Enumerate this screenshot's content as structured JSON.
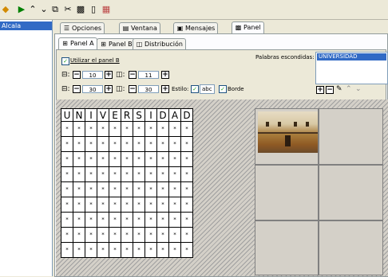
{
  "sidebar": {
    "items": [
      {
        "label": "Alcala"
      }
    ]
  },
  "tabs_main": [
    {
      "label": "Opciones",
      "icon": "options-icon"
    },
    {
      "label": "Ventana",
      "icon": "window-icon"
    },
    {
      "label": "Mensajes",
      "icon": "messages-icon"
    },
    {
      "label": "Panel",
      "icon": "panel-icon"
    }
  ],
  "tabs_sub": [
    {
      "label": "Panel A"
    },
    {
      "label": "Panel B"
    },
    {
      "label": "Distribución"
    }
  ],
  "options": {
    "use_panel_b": "Utilizar el panel B",
    "hidden_words_label": "Palabras escondidas:",
    "hidden_words": [
      "UNIVERSIDAD"
    ],
    "rows_value": "10",
    "cols_value": "11",
    "width_value": "30",
    "height_value": "30",
    "style_label": "Estilo:",
    "style_value": "abc",
    "border_label": "Borde"
  },
  "grid": {
    "letters": [
      "U",
      "N",
      "I",
      "V",
      "E",
      "R",
      "S",
      "I",
      "D",
      "A",
      "D"
    ],
    "fill": "*",
    "rows": 9
  },
  "colors": {
    "selection": "#316ac5",
    "check": "#21a121"
  }
}
